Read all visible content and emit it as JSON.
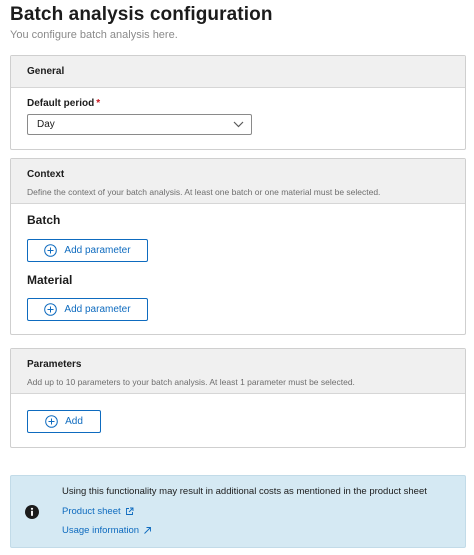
{
  "header": {
    "title": "Batch analysis configuration",
    "subtitle": "You configure batch analysis here."
  },
  "general": {
    "title": "General",
    "default_period_label": "Default period",
    "required_marker": "*",
    "default_period_value": "Day"
  },
  "context": {
    "title": "Context",
    "description": "Define the context of your batch analysis. At least one batch or one material must be selected.",
    "batch_label": "Batch",
    "batch_button": "Add parameter",
    "material_label": "Material",
    "material_button": "Add parameter"
  },
  "parameters": {
    "title": "Parameters",
    "description": "Add up to 10 parameters to your batch analysis. At least 1 parameter must be selected.",
    "add_button": "Add"
  },
  "info": {
    "message": "Using this functionality may result in additional costs as mentioned in the product sheet",
    "link_product_sheet": "Product sheet",
    "link_usage_information": "Usage information"
  },
  "icons": {
    "chevron": "chevron-down-icon",
    "add": "plus-circle-icon",
    "info": "info-icon",
    "external": "external-link-icon",
    "arrow": "arrow-up-right-icon"
  },
  "colors": {
    "accent": "#0e6bbf",
    "required": "#c9151e",
    "info_background": "#d5e9f3",
    "card_header": "#f0f0f0"
  }
}
